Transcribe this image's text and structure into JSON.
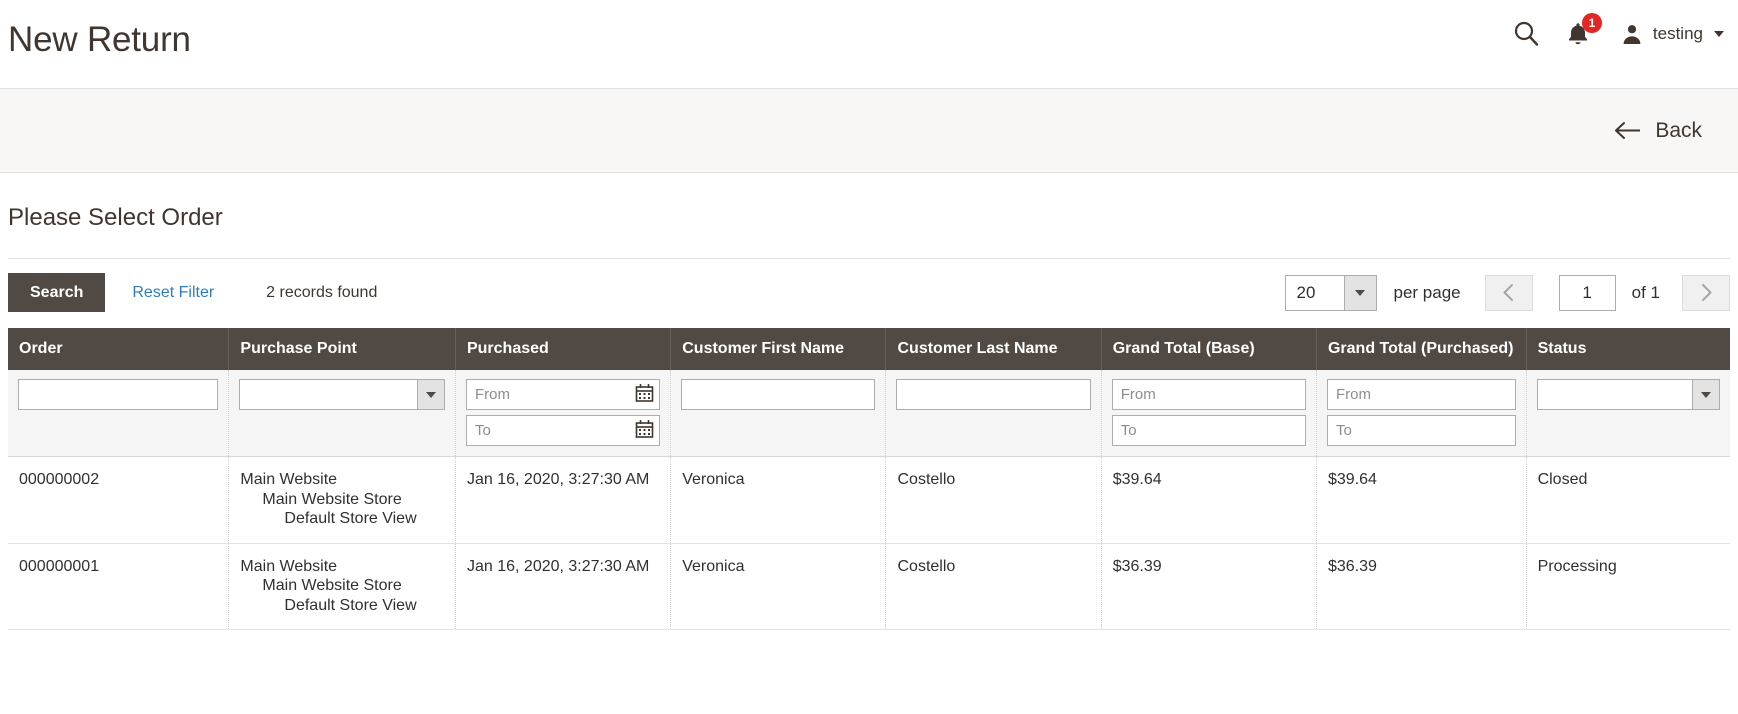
{
  "header": {
    "title": "New Return",
    "search_icon": "search-icon",
    "notifications_icon": "bell-icon",
    "notifications_count": "1",
    "user_icon": "user-avatar-icon",
    "user_name": "testing",
    "user_caret": "chevron-down-icon"
  },
  "page_actions": {
    "back_label": "Back",
    "back_icon": "arrow-left-icon"
  },
  "section": {
    "title": "Please Select Order"
  },
  "toolbar": {
    "search_label": "Search",
    "reset_filter_label": "Reset Filter",
    "records_found": "2 records found",
    "per_page_value": "20",
    "per_page_label": "per page",
    "prev_icon": "chevron-left-icon",
    "next_icon": "chevron-right-icon",
    "current_page": "1",
    "of_total": "of 1"
  },
  "grid": {
    "columns": [
      "Order",
      "Purchase Point",
      "Purchased",
      "Customer First Name",
      "Customer Last Name",
      "Grand Total (Base)",
      "Grand Total (Purchased)",
      "Status"
    ],
    "filters": {
      "order": "",
      "purchase_point": "",
      "purchased_from_placeholder": "From",
      "purchased_to_placeholder": "To",
      "purchased_from": "",
      "purchased_to": "",
      "customer_first_name": "",
      "customer_last_name": "",
      "grand_total_base_from_placeholder": "From",
      "grand_total_base_to_placeholder": "To",
      "grand_total_base_from": "",
      "grand_total_base_to": "",
      "grand_total_purchased_from_placeholder": "From",
      "grand_total_purchased_to_placeholder": "To",
      "grand_total_purchased_from": "",
      "grand_total_purchased_to": "",
      "status": "",
      "calendar_icon": "calendar-icon",
      "select_arrow_icon": "chevron-down-icon"
    },
    "rows": [
      {
        "order": "000000002",
        "purchase_point_website": "Main Website",
        "purchase_point_store": "Main Website Store",
        "purchase_point_view": "Default Store View",
        "purchased": "Jan 16, 2020, 3:27:30 AM",
        "first_name": "Veronica",
        "last_name": "Costello",
        "grand_total_base": "$39.64",
        "grand_total_purchased": "$39.64",
        "status": "Closed"
      },
      {
        "order": "000000001",
        "purchase_point_website": "Main Website",
        "purchase_point_store": "Main Website Store",
        "purchase_point_view": "Default Store View",
        "purchased": "Jan 16, 2020, 3:27:30 AM",
        "first_name": "Veronica",
        "last_name": "Costello",
        "grand_total_base": "$36.39",
        "grand_total_purchased": "$36.39",
        "status": "Processing"
      }
    ]
  },
  "colors": {
    "header_bar": "#514943",
    "link": "#2e7ebd",
    "badge": "#e22626",
    "text": "#41362f"
  }
}
